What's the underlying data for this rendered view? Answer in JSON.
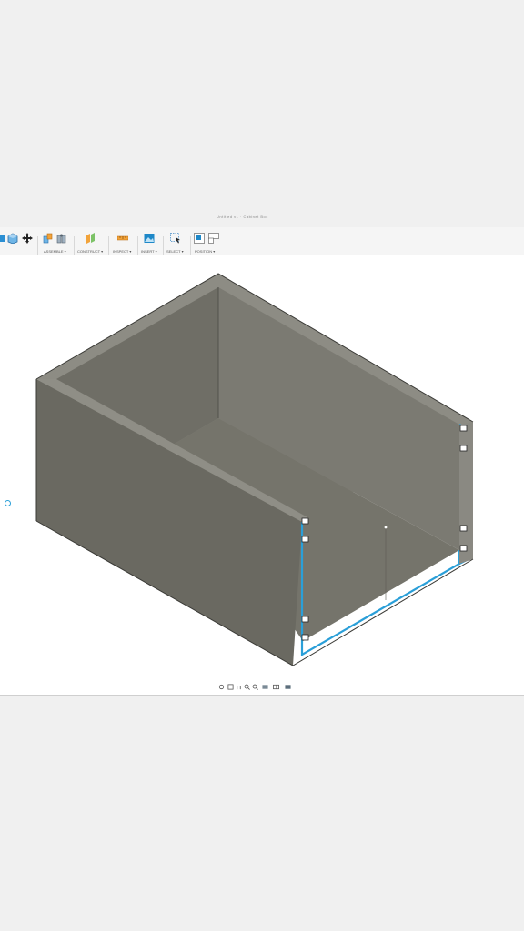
{
  "window": {
    "title": "Untitled v1 · Cabinet Box"
  },
  "toolbar": {
    "groups": [
      {
        "label": "",
        "icons": [
          "new-component-icon",
          "create-box-icon",
          "move-icon"
        ]
      },
      {
        "label": "ASSEMBLE ▾",
        "icons": [
          "joint-icon",
          "as-built-joint-icon"
        ]
      },
      {
        "label": "CONSTRUCT ▾",
        "icons": [
          "offset-plane-icon"
        ]
      },
      {
        "label": "INSPECT ▾",
        "icons": [
          "measure-icon"
        ]
      },
      {
        "label": "INSERT ▾",
        "icons": [
          "insert-image-icon"
        ]
      },
      {
        "label": "SELECT ▾",
        "icons": [
          "select-icon"
        ]
      },
      {
        "label": "POSITION ▾",
        "icons": [
          "capture-position-icon",
          "revert-position-icon"
        ]
      }
    ]
  },
  "navigation_bar": {
    "icons": [
      "orbit-icon",
      "look-at-icon",
      "pan-icon",
      "zoom-icon",
      "fit-icon",
      "display-settings-icon",
      "grid-icon",
      "viewports-icon"
    ]
  },
  "colors": {
    "model_face_light": "#7b7a72",
    "model_face_dark": "#636259",
    "model_top_edge": "#8d8c84",
    "model_floor": "#77766c",
    "selection_blue": "#2a9fd8",
    "viewport_bg": "#ffffff",
    "toolbar_accent": "#1e88c8"
  }
}
